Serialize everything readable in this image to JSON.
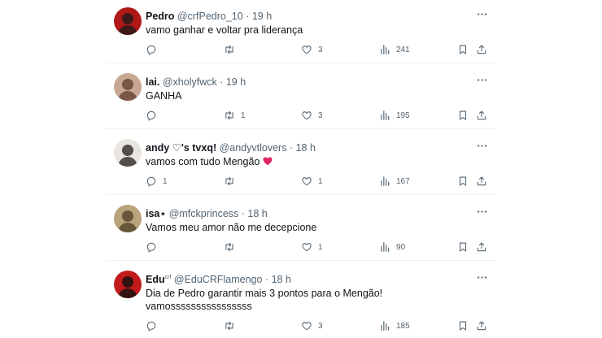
{
  "tweets": [
    {
      "name": "Pedro",
      "name_sup": "",
      "handle": "@crfPedro_10",
      "time": "19 h",
      "lines": [
        "vamo ganhar e voltar pra liderança"
      ],
      "reply_count": "",
      "retweet_count": "",
      "like_count": "3",
      "view_count": "241",
      "avatar_colors": {
        "bg": "#b01818",
        "fg": "#2a1a18"
      }
    },
    {
      "name": "lai.",
      "name_sup": "",
      "handle": "@xholyfwck",
      "time": "19 h",
      "lines": [
        "GANHA"
      ],
      "reply_count": "",
      "retweet_count": "1",
      "like_count": "3",
      "view_count": "195",
      "avatar_colors": {
        "bg": "#c8a893",
        "fg": "#6b4a3a"
      }
    },
    {
      "name": "andy ♡'s tvxq!",
      "name_sup": "",
      "handle": "@andyvtlovers",
      "time": "18 h",
      "lines": [
        "vamos com tudo Mengão"
      ],
      "emoji": "heart",
      "reply_count": "1",
      "retweet_count": "",
      "like_count": "1",
      "view_count": "167",
      "avatar_colors": {
        "bg": "#e8e4df",
        "fg": "#3a332e"
      }
    },
    {
      "name": "isa⋆",
      "name_sup": "",
      "handle": "@mfckprincess",
      "time": "18 h",
      "lines": [
        "Vamos meu amor não me decepcione"
      ],
      "reply_count": "",
      "retweet_count": "",
      "like_count": "1",
      "view_count": "90",
      "avatar_colors": {
        "bg": "#b9a37a",
        "fg": "#5a4a30"
      }
    },
    {
      "name": "Edu",
      "name_sup": "crf",
      "handle": "@EduCRFlamengo",
      "time": "18 h",
      "lines": [
        "Dia de Pedro garantir mais 3 pontos para o Mengão!",
        "vamossssssssssssssss"
      ],
      "reply_count": "",
      "retweet_count": "",
      "like_count": "3",
      "view_count": "185",
      "avatar_colors": {
        "bg": "#c21a1a",
        "fg": "#1b1010"
      }
    }
  ],
  "colors": {
    "muted": "#536471",
    "text": "#0f1419",
    "divider": "#eff3f4",
    "heart": "#e0245e"
  },
  "icons": [
    "reply-icon",
    "retweet-icon",
    "like-icon",
    "views-icon",
    "bookmark-icon",
    "share-icon",
    "more-icon"
  ]
}
